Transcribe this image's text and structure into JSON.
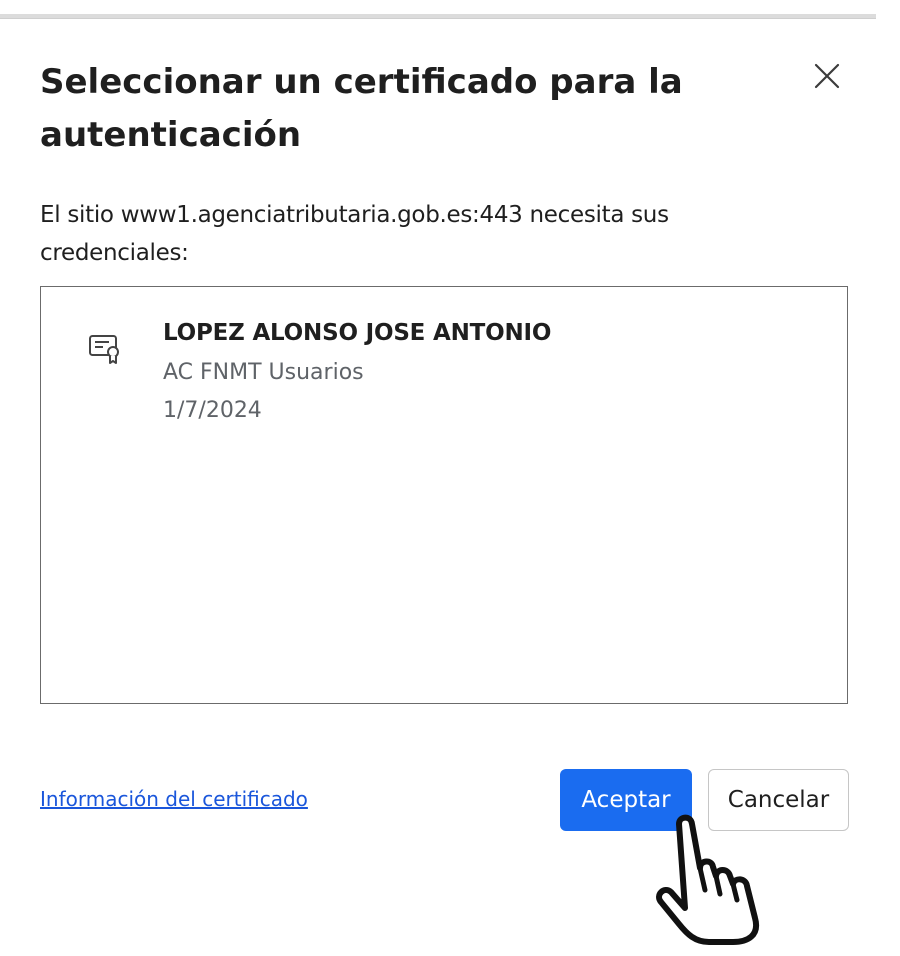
{
  "dialog": {
    "title": "Seleccionar un certificado para la autenticación",
    "message": "El sitio www1.agenciatributaria.gob.es:443 necesita sus credenciales:",
    "close_icon": "close-icon"
  },
  "certificates": [
    {
      "name": "LOPEZ ALONSO JOSE ANTONIO",
      "issuer": "AC FNMT Usuarios",
      "date": "1/7/2024",
      "icon": "certificate-icon"
    }
  ],
  "footer": {
    "info_link": "Información del certificado",
    "accept_label": "Aceptar",
    "cancel_label": "Cancelar"
  },
  "colors": {
    "accent": "#1a6cf0",
    "link": "#1a56db"
  },
  "cursor": "pointing-hand-cursor-icon"
}
